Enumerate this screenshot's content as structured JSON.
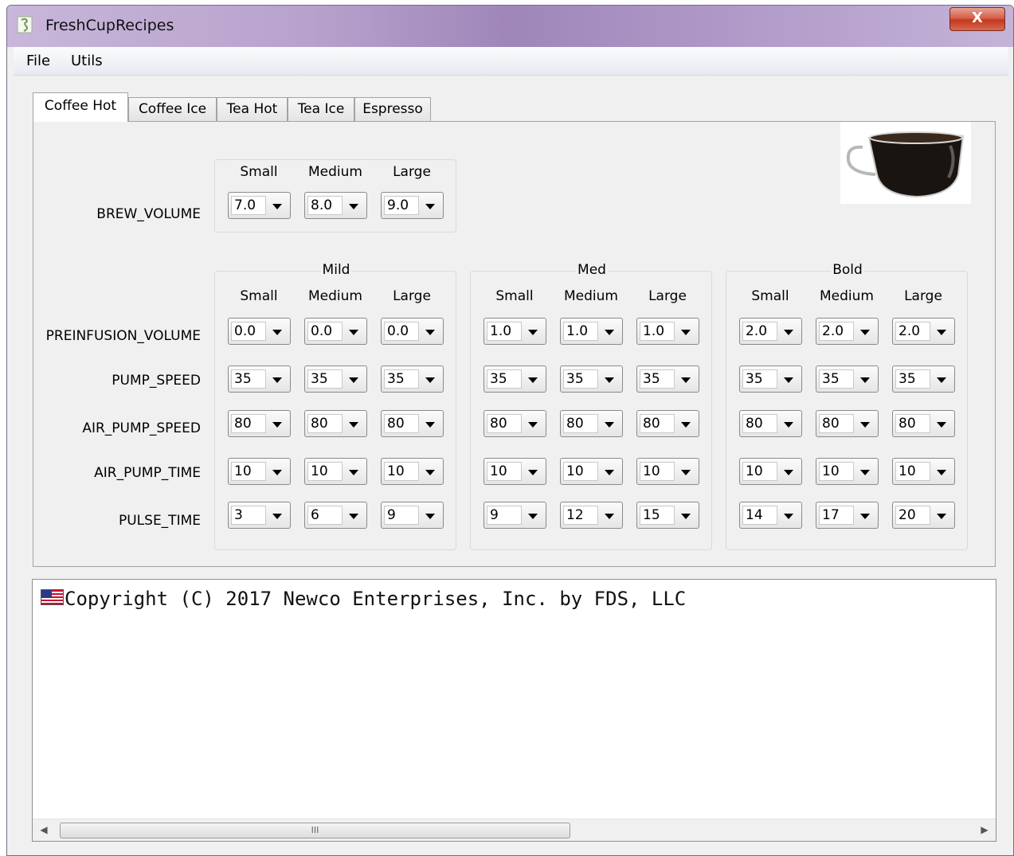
{
  "window": {
    "title": "FreshCupRecipes",
    "close_label": "X"
  },
  "menu": [
    "File",
    "Utils"
  ],
  "tabs": [
    "Coffee Hot",
    "Coffee Ice",
    "Tea Hot",
    "Tea Ice",
    "Espresso"
  ],
  "active_tab": "Coffee Hot",
  "sizes": [
    "Small",
    "Medium",
    "Large"
  ],
  "brew": {
    "label": "BREW_VOLUME",
    "values": [
      "7.0",
      "8.0",
      "9.0"
    ]
  },
  "strengths": [
    "Mild",
    "Med",
    "Bold"
  ],
  "params": [
    {
      "label": "PREINFUSION_VOLUME",
      "values": [
        [
          "0.0",
          "0.0",
          "0.0"
        ],
        [
          "1.0",
          "1.0",
          "1.0"
        ],
        [
          "2.0",
          "2.0",
          "2.0"
        ]
      ]
    },
    {
      "label": "PUMP_SPEED",
      "values": [
        [
          "35",
          "35",
          "35"
        ],
        [
          "35",
          "35",
          "35"
        ],
        [
          "35",
          "35",
          "35"
        ]
      ]
    },
    {
      "label": "AIR_PUMP_SPEED",
      "values": [
        [
          "80",
          "80",
          "80"
        ],
        [
          "80",
          "80",
          "80"
        ],
        [
          "80",
          "80",
          "80"
        ]
      ]
    },
    {
      "label": "AIR_PUMP_TIME",
      "values": [
        [
          "10",
          "10",
          "10"
        ],
        [
          "10",
          "10",
          "10"
        ],
        [
          "10",
          "10",
          "10"
        ]
      ]
    },
    {
      "label": "PULSE_TIME",
      "values": [
        [
          "3",
          "6",
          "9"
        ],
        [
          "9",
          "12",
          "15"
        ],
        [
          "14",
          "17",
          "20"
        ]
      ]
    }
  ],
  "console": {
    "text": "Copyright (C) 2017 Newco Enterprises, Inc. by FDS, LLC",
    "scroll_thumb": "III"
  }
}
